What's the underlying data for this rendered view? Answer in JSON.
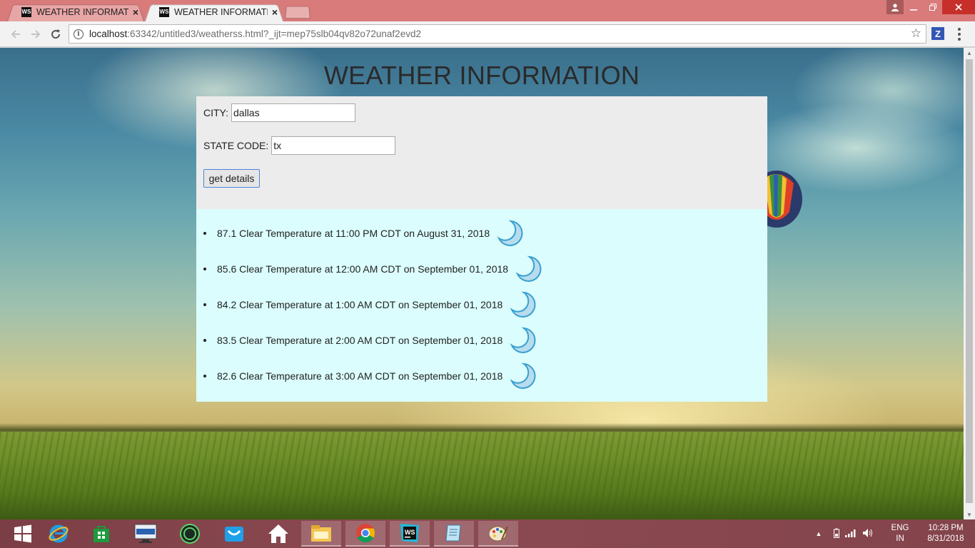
{
  "browser": {
    "tabs": [
      {
        "favicon": "WS",
        "title": "WEATHER INFORMATION",
        "close": "×",
        "active": false
      },
      {
        "favicon": "WS",
        "title": "WEATHER INFORMATION",
        "close": "×",
        "active": true
      }
    ],
    "url_host": "localhost",
    "url_path": ":63342/untitled3/weatherss.html?_ijt=mep75slb04qv82o72unaf2evd2",
    "extension_letter": "Z"
  },
  "page": {
    "heading": "WEATHER INFORMATION",
    "form": {
      "city_label": "CITY:",
      "city_value": "dallas",
      "state_label": "STATE CODE:",
      "state_value": "tx",
      "button_label": "get details"
    },
    "results": [
      {
        "text": "87.1 Clear Temperature at 11:00 PM CDT on August 31, 2018",
        "icon": "moon-icon"
      },
      {
        "text": "85.6 Clear Temperature at 12:00 AM CDT on September 01, 2018",
        "icon": "moon-icon"
      },
      {
        "text": "84.2 Clear Temperature at 1:00 AM CDT on September 01, 2018",
        "icon": "moon-icon"
      },
      {
        "text": "83.5 Clear Temperature at 2:00 AM CDT on September 01, 2018",
        "icon": "moon-icon"
      },
      {
        "text": "82.6 Clear Temperature at 3:00 AM CDT on September 01, 2018",
        "icon": "moon-icon"
      }
    ]
  },
  "taskbar": {
    "apps": [
      "windows-start-icon",
      "internet-explorer-icon",
      "store-icon",
      "lenovo-icon",
      "circle-app-icon",
      "mail-icon",
      "home-icon",
      "file-explorer-icon",
      "chrome-icon",
      "webstorm-icon",
      "notepad-icon",
      "paint-icon"
    ],
    "lang_line1": "ENG",
    "lang_line2": "IN",
    "time": "10:28 PM",
    "date": "8/31/2018"
  },
  "colors": {
    "tabstrip": "#d97b7b",
    "form_panel": "#ececec",
    "results_panel": "#dbfdfd",
    "taskbar": "#84444c"
  }
}
